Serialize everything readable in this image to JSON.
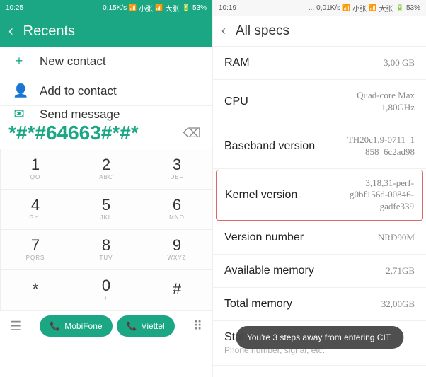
{
  "left": {
    "status": {
      "time": "10:25",
      "speed": "0,15K/s",
      "carrier1": "小张",
      "carrier2": "大张",
      "battery": "53%"
    },
    "header": {
      "title": "Recents"
    },
    "actions": [
      {
        "icon": "+",
        "label": "New contact"
      },
      {
        "icon": "👤",
        "label": "Add to contact"
      },
      {
        "icon": "✉",
        "label": "Send message"
      }
    ],
    "dial": {
      "value": "*#*#64663#*#*"
    },
    "keys": [
      {
        "num": "1",
        "sub": "QO"
      },
      {
        "num": "2",
        "sub": "ABC"
      },
      {
        "num": "3",
        "sub": "DEF"
      },
      {
        "num": "4",
        "sub": "GHI"
      },
      {
        "num": "5",
        "sub": "JKL"
      },
      {
        "num": "6",
        "sub": "MNO"
      },
      {
        "num": "7",
        "sub": "PQRS"
      },
      {
        "num": "8",
        "sub": "TUV"
      },
      {
        "num": "9",
        "sub": "WXYZ"
      },
      {
        "num": "*",
        "sub": ""
      },
      {
        "num": "0",
        "sub": "+"
      },
      {
        "num": "#",
        "sub": ""
      }
    ],
    "call1": "MobiFone",
    "call2": "Viettel"
  },
  "right": {
    "status": {
      "time": "10:19",
      "speed": "0,01K/s",
      "carrier1": "小张",
      "carrier2": "大张",
      "battery": "53%"
    },
    "header": {
      "title": "All specs"
    },
    "specs": [
      {
        "label": "RAM",
        "value": "3,00 GB",
        "highlight": false
      },
      {
        "label": "CPU",
        "value": "Quad-core Max\n1,80GHz",
        "highlight": false
      },
      {
        "label": "Baseband version",
        "value": "TH20c1,9-0711_1\n858_6c2ad98",
        "highlight": false
      },
      {
        "label": "Kernel version",
        "value": "3,18,31-perf-\ng0bf156d-00846-\ngadfe339",
        "highlight": true
      },
      {
        "label": "Version number",
        "value": "NRD90M",
        "highlight": false
      },
      {
        "label": "Available memory",
        "value": "2,71GB",
        "highlight": false
      },
      {
        "label": "Total memory",
        "value": "32,00GB",
        "highlight": false
      }
    ],
    "status_row": {
      "label": "Status",
      "sub": "Phone number, signal, etc."
    },
    "toast": "You're 3 steps away from entering CIT."
  }
}
